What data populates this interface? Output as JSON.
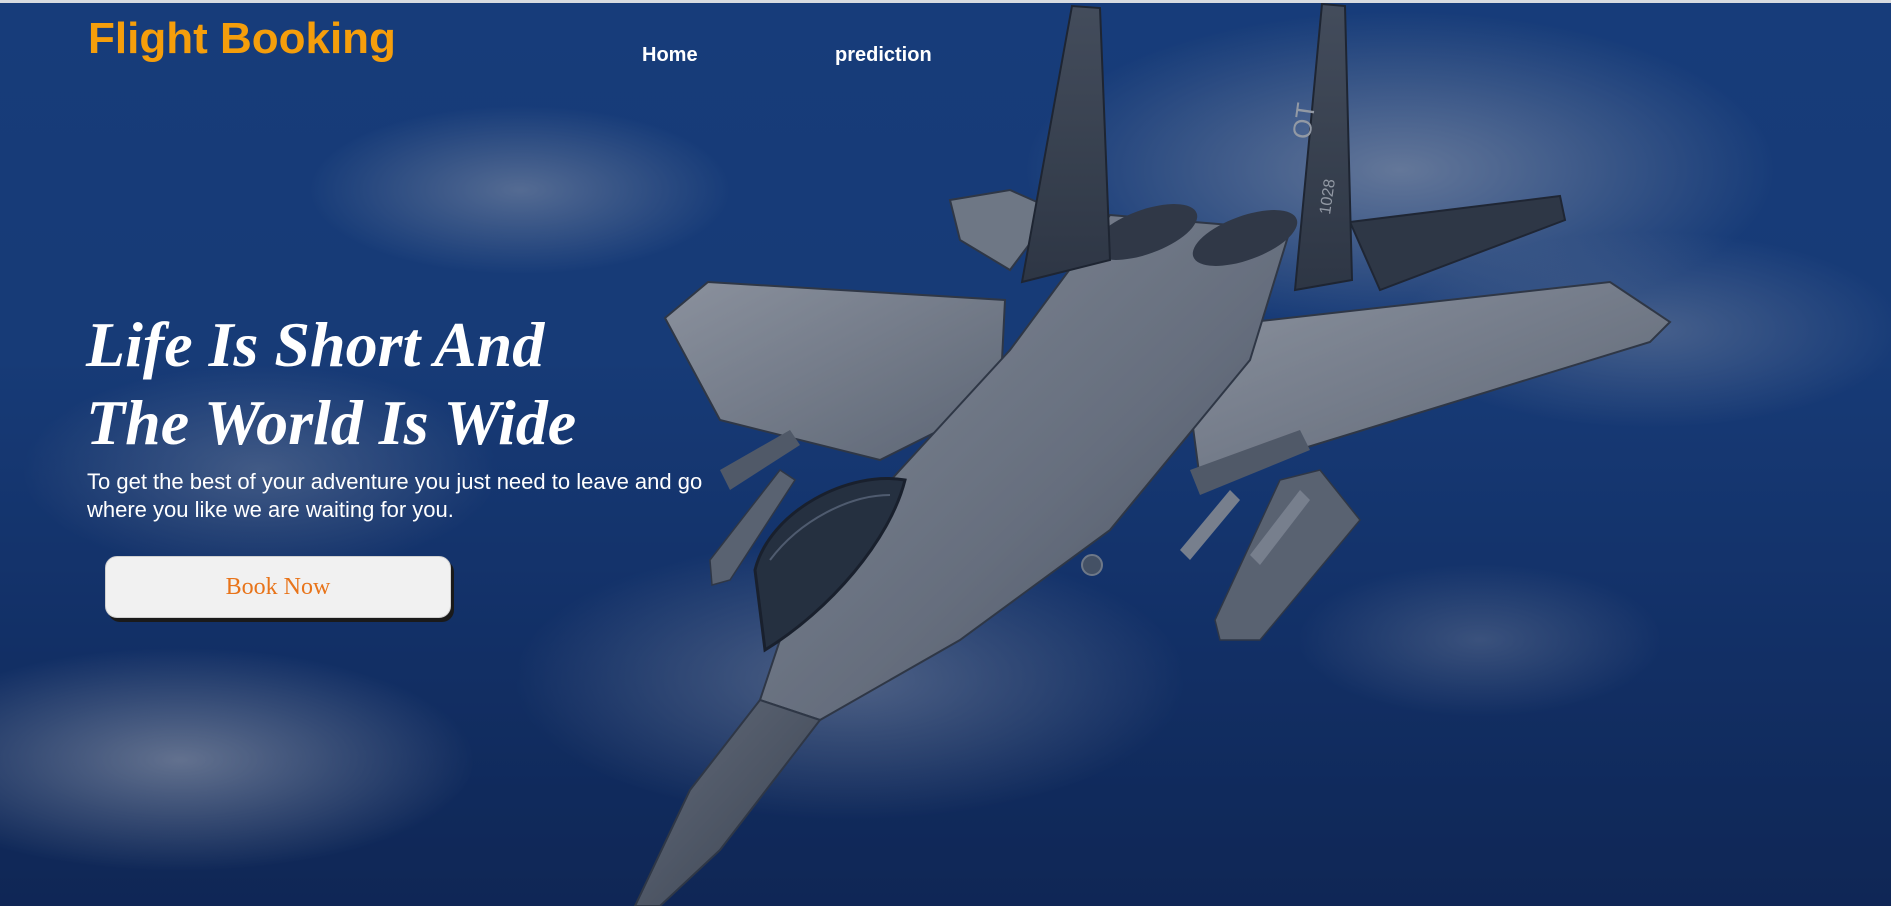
{
  "brand": {
    "title": "Flight Booking"
  },
  "nav": {
    "items": [
      {
        "label": "Home"
      },
      {
        "label": "prediction"
      }
    ]
  },
  "hero": {
    "headline_line1": "Life Is Short And",
    "headline_line2": "The World Is Wide",
    "subtitle": "To get the best of your adventure you just need to leave and go where you like we are waiting for you.",
    "cta_label": "Book Now"
  },
  "background": {
    "subject": "fighter jet flying above clouds",
    "jet_markings": [
      "OT",
      "1028"
    ]
  },
  "colors": {
    "brand": "#f59e0b",
    "cta_text": "#e8741a",
    "sky": "#1a4c9c"
  }
}
